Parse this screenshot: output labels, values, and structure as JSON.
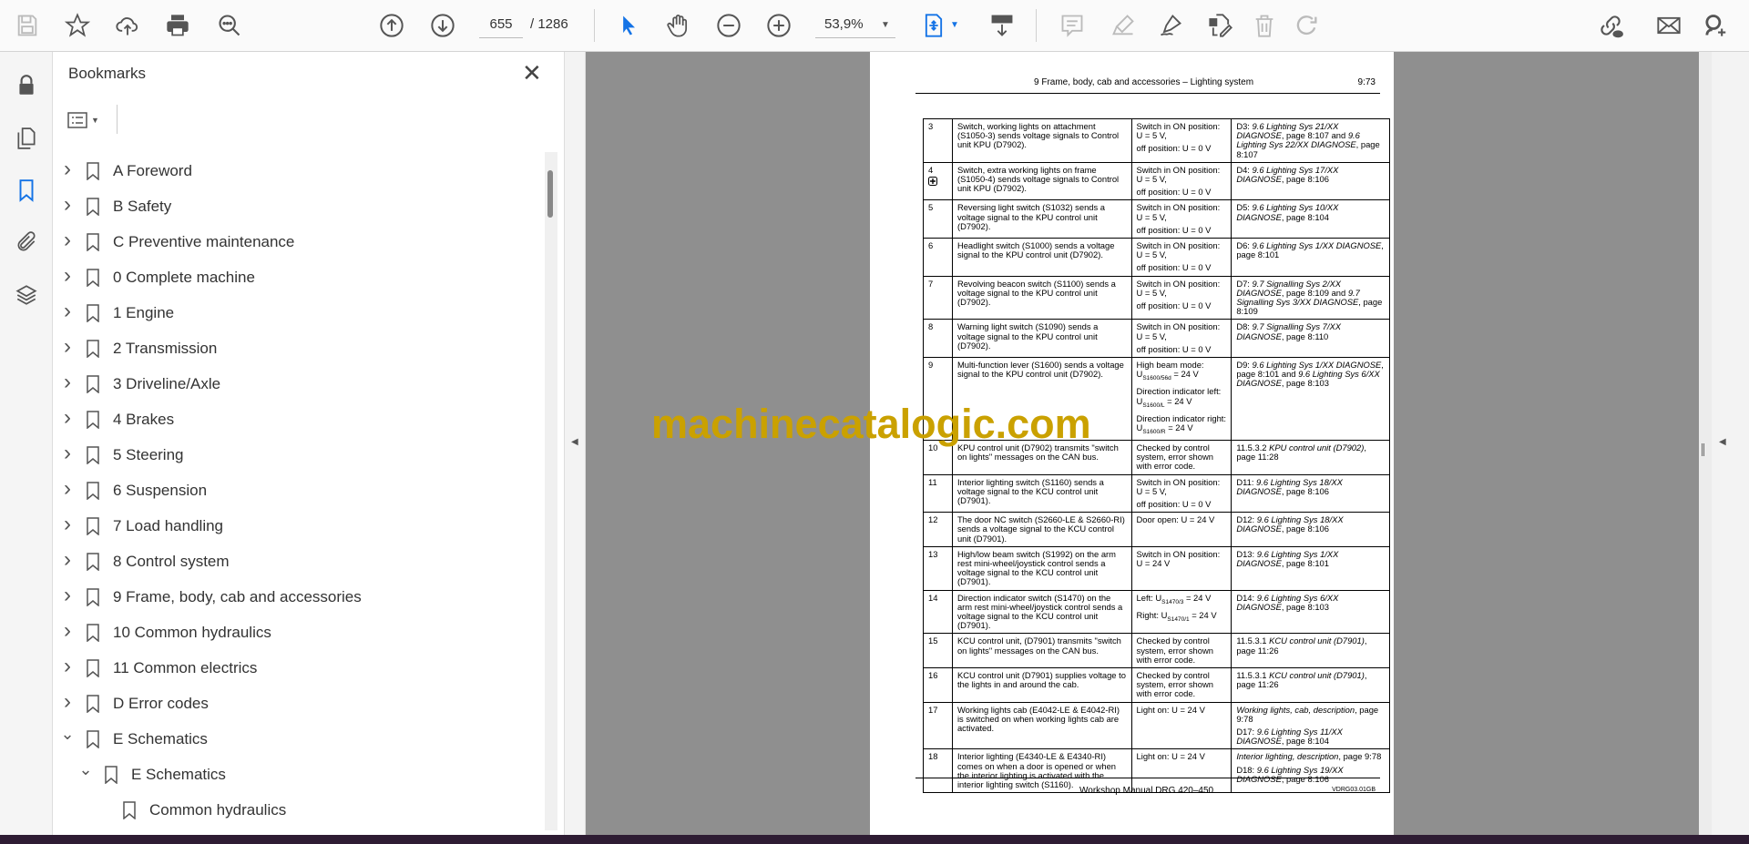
{
  "toolbar": {
    "page_current": "655",
    "page_total": "/ 1286",
    "zoom": "53,9%"
  },
  "sidebar": {
    "title": "Bookmarks",
    "close": "✕"
  },
  "bookmarks": [
    {
      "label": "A Foreword",
      "state": "collapsed",
      "level": 0
    },
    {
      "label": "B Safety",
      "state": "collapsed",
      "level": 0
    },
    {
      "label": "C Preventive maintenance",
      "state": "collapsed",
      "level": 0
    },
    {
      "label": "0 Complete machine",
      "state": "collapsed",
      "level": 0
    },
    {
      "label": "1 Engine",
      "state": "collapsed",
      "level": 0
    },
    {
      "label": "2 Transmission",
      "state": "collapsed",
      "level": 0
    },
    {
      "label": "3 Driveline/Axle",
      "state": "collapsed",
      "level": 0
    },
    {
      "label": "4 Brakes",
      "state": "collapsed",
      "level": 0
    },
    {
      "label": "5 Steering",
      "state": "collapsed",
      "level": 0
    },
    {
      "label": "6 Suspension",
      "state": "collapsed",
      "level": 0
    },
    {
      "label": "7 Load handling",
      "state": "collapsed",
      "level": 0
    },
    {
      "label": "8 Control system",
      "state": "collapsed",
      "level": 0
    },
    {
      "label": "9 Frame, body, cab and accessories",
      "state": "collapsed",
      "level": 0
    },
    {
      "label": "10 Common hydraulics",
      "state": "collapsed",
      "level": 0
    },
    {
      "label": "11 Common electrics",
      "state": "collapsed",
      "level": 0
    },
    {
      "label": "D Error codes",
      "state": "collapsed",
      "level": 0
    },
    {
      "label": "E Schematics",
      "state": "expanded",
      "level": 0
    },
    {
      "label": "E Schematics",
      "state": "expanded",
      "level": 1
    },
    {
      "label": "Common hydraulics",
      "state": "leaf",
      "level": 2
    }
  ],
  "page": {
    "header_title": "9  Frame, body, cab and accessories – Lighting system",
    "header_page": "9:73",
    "footer_title": "Workshop Manual DRG 420–450",
    "footer_code": "VDRG03.01GB",
    "watermark": "machinecatalogic.com",
    "rows": [
      {
        "n": "3",
        "desc": "Switch, working lights on attachment (S1050-3) sends voltage signals to Control unit KPU (D7902).",
        "val": [
          [
            [
              "Switch in ON position: U = 5 V,",
              ""
            ]
          ],
          [
            [
              "off position: U = 0 V",
              ""
            ]
          ]
        ],
        "ref": [
          [
            [
              "D3:  ",
              ""
            ],
            [
              "9.6 Lighting Sys 21/XX DIAGNOSE",
              "i"
            ],
            [
              ", page 8:107 and ",
              ""
            ],
            [
              "9.6 Lighting Sys 22/XX DIAGNOSE",
              "i"
            ],
            [
              ", page 8:107",
              ""
            ]
          ]
        ]
      },
      {
        "n": "4",
        "icon": "plus",
        "desc": "Switch, extra working lights on frame (S1050-4) sends voltage signals to Control unit KPU (D7902).",
        "val": [
          [
            [
              "Switch in ON position: U = 5 V,",
              ""
            ]
          ],
          [
            [
              "off position: U = 0 V",
              ""
            ]
          ]
        ],
        "ref": [
          [
            [
              "D4:  ",
              ""
            ],
            [
              "9.6 Lighting Sys 17/XX DIAGNOSE",
              "i"
            ],
            [
              ", page 8:106",
              ""
            ]
          ]
        ]
      },
      {
        "n": "5",
        "desc": "Reversing light switch (S1032) sends a voltage signal to the KPU control unit (D7902).",
        "val": [
          [
            [
              "Switch in ON position: U = 5 V,",
              ""
            ]
          ],
          [
            [
              "off position: U = 0 V",
              ""
            ]
          ]
        ],
        "ref": [
          [
            [
              "D5:  ",
              ""
            ],
            [
              "9.6 Lighting Sys 10/XX DIAGNOSE",
              "i"
            ],
            [
              ", page 8:104",
              ""
            ]
          ]
        ]
      },
      {
        "n": "6",
        "desc": "Headlight switch (S1000) sends a voltage signal to the KPU control unit (D7902).",
        "val": [
          [
            [
              "Switch in ON position: U = 5 V,",
              ""
            ]
          ],
          [
            [
              "off position: U = 0 V",
              ""
            ]
          ]
        ],
        "ref": [
          [
            [
              "D6: ",
              ""
            ],
            [
              "9.6 Lighting Sys 1/XX DIAGNOSE",
              "i"
            ],
            [
              ", page 8:101",
              ""
            ]
          ]
        ]
      },
      {
        "n": "7",
        "desc": "Revolving beacon switch (S1100) sends a voltage signal to the KPU control unit (D7902).",
        "val": [
          [
            [
              "Switch in ON position: U = 5 V,",
              ""
            ]
          ],
          [
            [
              "off position: U = 0 V",
              ""
            ]
          ]
        ],
        "ref": [
          [
            [
              "D7:  ",
              ""
            ],
            [
              "9.7 Signalling Sys 2/XX DIAGNOSE",
              "i"
            ],
            [
              ", page 8:109 and ",
              ""
            ],
            [
              "9.7 Signalling Sys 3/XX DIAGNOSE",
              "i"
            ],
            [
              ", page 8:109",
              ""
            ]
          ]
        ]
      },
      {
        "n": "8",
        "desc": "Warning light switch (S1090) sends a voltage signal to the KPU control unit (D7902).",
        "val": [
          [
            [
              "Switch in ON position: U = 5 V,",
              ""
            ]
          ],
          [
            [
              "off position: U = 0 V",
              ""
            ]
          ]
        ],
        "ref": [
          [
            [
              "D8:  ",
              ""
            ],
            [
              "9.7 Signalling Sys 7/XX DIAGNOSE",
              "i"
            ],
            [
              ", page 8:110",
              ""
            ]
          ]
        ]
      },
      {
        "n": "9",
        "desc": "Multi-function lever (S1600) sends a voltage signal to the KPU control unit (D7902).",
        "val": [
          [
            [
              "High beam mode: U",
              ""
            ],
            [
              "S1600/56d",
              "sub"
            ],
            [
              " = 24 V",
              ""
            ]
          ],
          [
            [
              "Direction indicator left: U",
              ""
            ],
            [
              "S1600/L",
              "sub"
            ],
            [
              " = 24 V",
              ""
            ]
          ],
          [
            [
              "Direction indicator right: U",
              ""
            ],
            [
              "S1600/R",
              "sub"
            ],
            [
              " = 24 V",
              ""
            ]
          ]
        ],
        "ref": [
          [
            [
              "D9: ",
              ""
            ],
            [
              "9.6 Lighting Sys 1/XX DIAGNOSE",
              "i"
            ],
            [
              ", page 8:101 and ",
              ""
            ],
            [
              "9.6 Lighting Sys 6/XX DIAGNOSE",
              "i"
            ],
            [
              ", page 8:103",
              ""
            ]
          ]
        ]
      },
      {
        "n": "10",
        "desc": "KPU control unit (D7902) transmits \"switch on lights\" messages on the CAN bus.",
        "val": [
          [
            [
              "Checked by control system, error shown with error code.",
              ""
            ]
          ]
        ],
        "ref": [
          [
            [
              "11.5.3.2 ",
              ""
            ],
            [
              "KPU control unit (D7902)",
              "i"
            ],
            [
              ", page 11:28",
              ""
            ]
          ]
        ]
      },
      {
        "n": "11",
        "desc": "Interior lighting switch (S1160) sends a voltage signal to the KCU control unit (D7901).",
        "val": [
          [
            [
              "Switch in ON position: U = 5 V,",
              ""
            ]
          ],
          [
            [
              "off position: U = 0 V",
              ""
            ]
          ]
        ],
        "ref": [
          [
            [
              "D11:  ",
              ""
            ],
            [
              "9.6 Lighting Sys 18/XX DIAGNOSE",
              "i"
            ],
            [
              ", page 8:106",
              ""
            ]
          ]
        ]
      },
      {
        "n": "12",
        "desc": "The door NC switch (S2660-LE & S2660-RI) sends a voltage signal to the KCU control unit (D7901).",
        "val": [
          [
            [
              "Door open: U = 24 V",
              ""
            ]
          ]
        ],
        "ref": [
          [
            [
              "D12:  ",
              ""
            ],
            [
              "9.6 Lighting Sys 18/XX DIAGNOSE",
              "i"
            ],
            [
              ", page 8:106",
              ""
            ]
          ]
        ]
      },
      {
        "n": "13",
        "desc": "High/low beam switch (S1992) on the arm rest mini-wheel/joystick control sends a voltage signal to the KCU control unit (D7901).",
        "val": [
          [
            [
              "Switch in ON position: U = 24 V",
              ""
            ]
          ]
        ],
        "ref": [
          [
            [
              "D13:  ",
              ""
            ],
            [
              "9.6 Lighting Sys 1/XX DIAGNOSE",
              "i"
            ],
            [
              ", page 8:101",
              ""
            ]
          ]
        ]
      },
      {
        "n": "14",
        "desc": "Direction indicator switch (S1470) on the arm rest mini-wheel/joystick control sends a voltage signal to the KCU control unit (D7901).",
        "val": [
          [
            [
              "Left: U",
              ""
            ],
            [
              "S1470/3",
              "sub"
            ],
            [
              " = 24 V",
              ""
            ]
          ],
          [
            [
              "Right: U",
              ""
            ],
            [
              "S1470/1",
              "sub"
            ],
            [
              " = 24 V",
              ""
            ]
          ]
        ],
        "ref": [
          [
            [
              "D14:  ",
              ""
            ],
            [
              "9.6 Lighting Sys 6/XX DIAGNOSE",
              "i"
            ],
            [
              ", page 8:103",
              ""
            ]
          ]
        ]
      },
      {
        "n": "15",
        "desc": "KCU control unit, (D7901) transmits \"switch on lights\" messages on the CAN bus.",
        "val": [
          [
            [
              "Checked by control system, error shown with error code.",
              ""
            ]
          ]
        ],
        "ref": [
          [
            [
              "11.5.3.1 ",
              ""
            ],
            [
              "KCU control unit (D7901)",
              "i"
            ],
            [
              ", page 11:26",
              ""
            ]
          ]
        ]
      },
      {
        "n": "16",
        "desc": "KCU control unit (D7901) supplies voltage to the lights in and around the cab.",
        "val": [
          [
            [
              "Checked by control system, error shown with error code.",
              ""
            ]
          ]
        ],
        "ref": [
          [
            [
              "11.5.3.1 ",
              ""
            ],
            [
              "KCU control unit (D7901)",
              "i"
            ],
            [
              ", page 11:26",
              ""
            ]
          ]
        ]
      },
      {
        "n": "17",
        "desc": "Working lights cab (E4042-LE & E4042-RI) is switched on when working lights cab are activated.",
        "val": [
          [
            [
              "Light on: U = 24 V",
              ""
            ]
          ]
        ],
        "ref": [
          [
            [
              "Working lights, cab, description",
              "i"
            ],
            [
              ", page 9:78",
              ""
            ]
          ],
          [
            [
              "D17:  ",
              ""
            ],
            [
              "9.6 Lighting Sys 11/XX DIAGNOSE",
              "i"
            ],
            [
              ", page 8:104",
              ""
            ]
          ]
        ]
      },
      {
        "n": "18",
        "desc": "Interior lighting (E4340-LE & E4340-RI) comes on when a door is opened or when the interior lighting is activated with the interior lighting switch (S1160).",
        "val": [
          [
            [
              "Light on: U = 24 V",
              ""
            ]
          ]
        ],
        "ref": [
          [
            [
              "Interior lighting, description",
              "i"
            ],
            [
              ", page 9:78",
              ""
            ]
          ],
          [
            [
              "D18:  ",
              ""
            ],
            [
              "9.6 Lighting Sys 19/XX DIAGNOSE",
              "i"
            ],
            [
              ", page 8:106",
              ""
            ]
          ]
        ]
      }
    ]
  },
  "colors": {
    "accent": "#1473e6",
    "watermark": "#caa100",
    "doc_bg": "#8f8f8f"
  }
}
